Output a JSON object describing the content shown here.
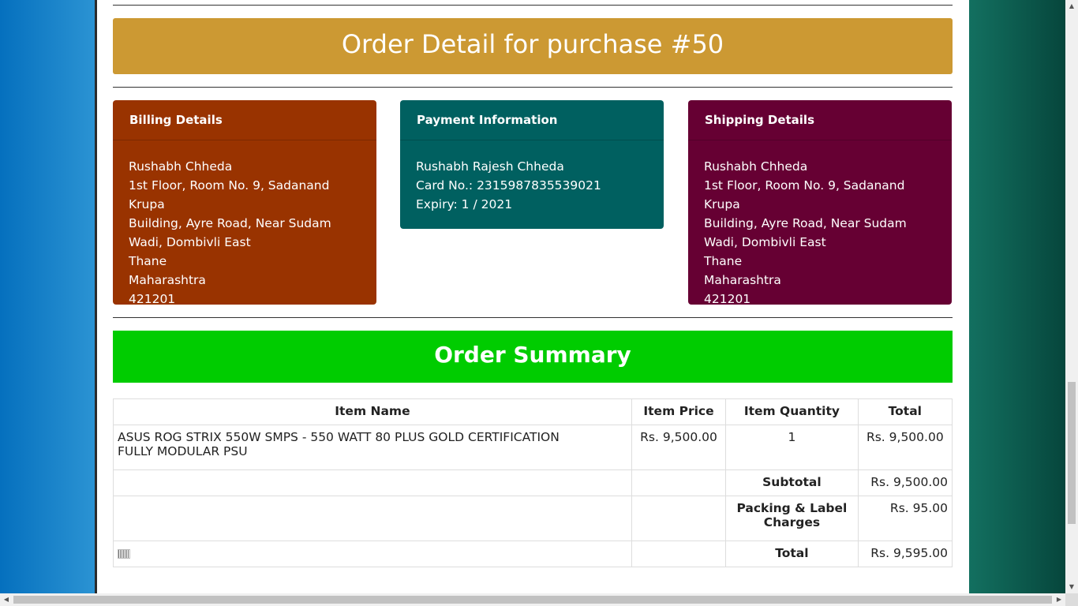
{
  "header": {
    "title": "Order Detail for purchase #50"
  },
  "billing": {
    "heading": "Billing Details",
    "lines": [
      "Rushabh Chheda",
      "1st Floor, Room No. 9, Sadanand Krupa",
      "Building, Ayre Road, Near Sudam",
      "Wadi, Dombivli East",
      "Thane",
      "Maharashtra",
      "421201"
    ]
  },
  "payment": {
    "heading": "Payment Information",
    "lines": [
      "Rushabh Rajesh Chheda",
      "Card No.: 2315987835539021",
      "Expiry: 1 / 2021"
    ]
  },
  "shipping": {
    "heading": "Shipping Details",
    "lines": [
      "Rushabh Chheda",
      "1st Floor, Room No. 9, Sadanand Krupa",
      "Building, Ayre Road, Near Sudam",
      "Wadi, Dombivli East",
      "Thane",
      "Maharashtra",
      "421201"
    ]
  },
  "summary": {
    "title": "Order Summary",
    "columns": [
      "Item Name",
      "Item Price",
      "Item Quantity",
      "Total"
    ],
    "items": [
      {
        "name_line1": "ASUS ROG STRIX 550W SMPS - 550 WATT 80 PLUS GOLD CERTIFICATION",
        "name_line2": "FULLY MODULAR PSU",
        "price": "Rs. 9,500.00",
        "qty": "1",
        "total": "Rs. 9,500.00"
      }
    ],
    "subtotal_label": "Subtotal",
    "subtotal_value": "Rs. 9,500.00",
    "packing_label_line1": "Packing & Label",
    "packing_label_line2": "Charges",
    "packing_value": "Rs. 95.00",
    "total_label": "Total",
    "total_value": "Rs. 9,595.00"
  },
  "colors": {
    "title_banner": "#cc9933",
    "billing": "#993300",
    "payment": "#006060",
    "shipping": "#660033",
    "summary_banner": "#00cc00"
  },
  "icons": {
    "barcode": "barcode-icon",
    "scroll_up": "arrow-up-icon",
    "scroll_down": "arrow-down-icon",
    "scroll_left": "arrow-left-icon",
    "scroll_right": "arrow-right-icon"
  }
}
